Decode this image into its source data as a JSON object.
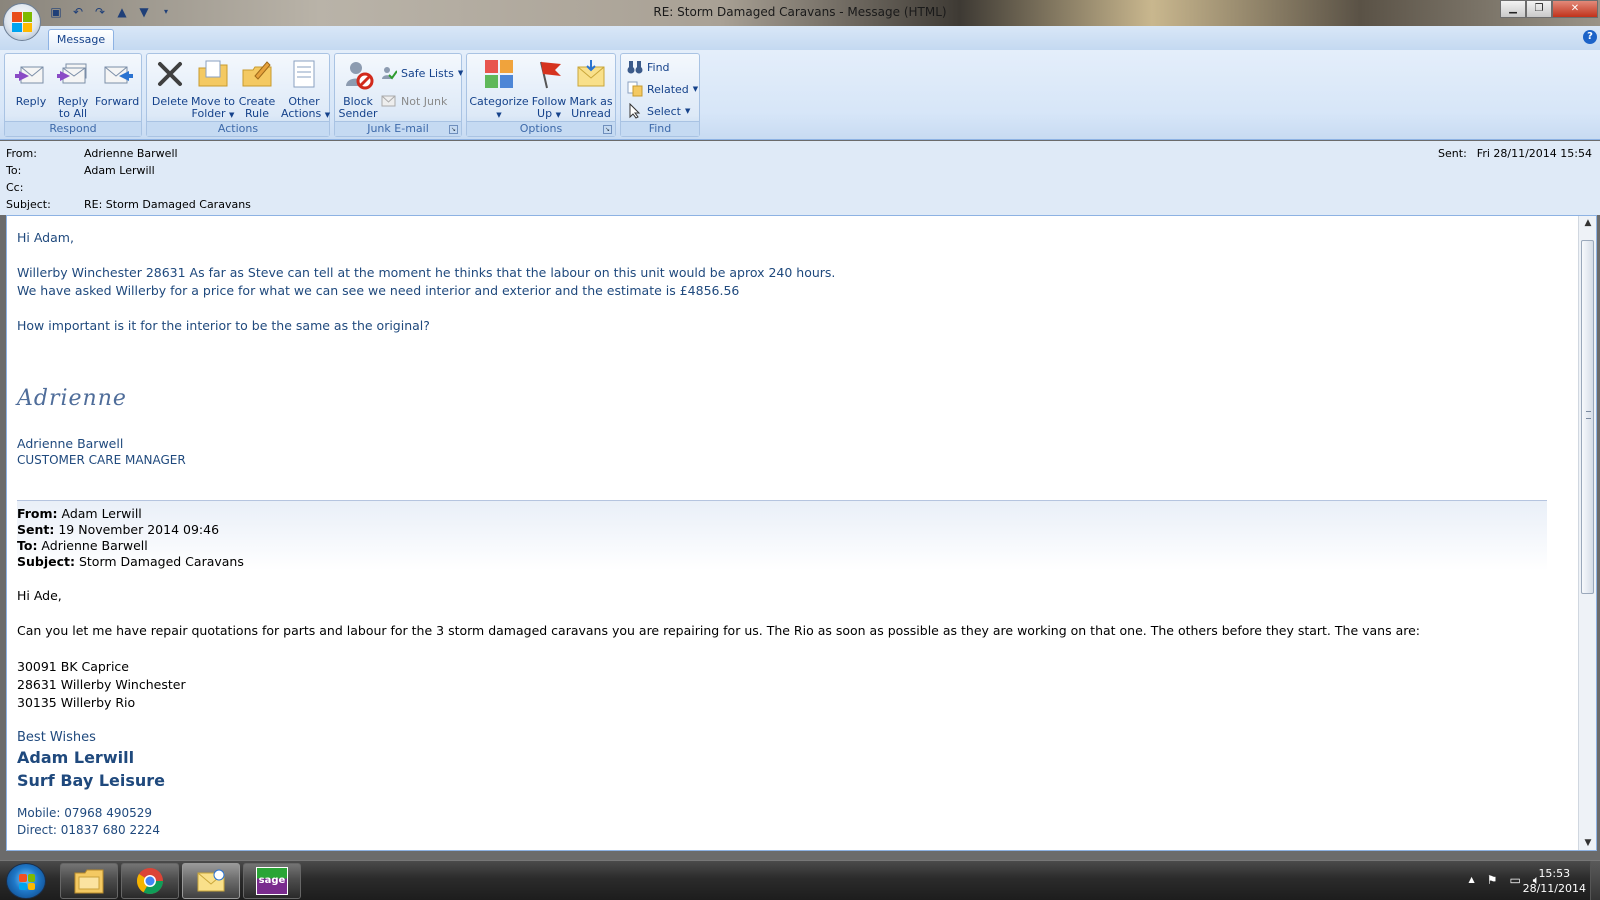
{
  "window": {
    "title": "RE: Storm Damaged Caravans - Message (HTML)",
    "minimize": "▁",
    "restore": "❐",
    "close": "✕"
  },
  "qat_icons": [
    "save-icon",
    "undo-icon",
    "redo-icon",
    "previous-item-icon",
    "next-item-icon",
    "customize-qat-icon"
  ],
  "ribbon": {
    "tab": "Message",
    "help": "?",
    "groups": {
      "respond": {
        "label": "Respond",
        "reply": "Reply",
        "reply_all_1": "Reply",
        "reply_all_2": "to All",
        "forward": "Forward"
      },
      "actions": {
        "label": "Actions",
        "delete": "Delete",
        "move_1": "Move to",
        "move_2": "Folder",
        "create_rule_1": "Create",
        "create_rule_2": "Rule",
        "other_1": "Other",
        "other_2": "Actions"
      },
      "junk": {
        "label": "Junk E-mail",
        "block_1": "Block",
        "block_2": "Sender",
        "safe_lists": "Safe Lists",
        "not_junk": "Not Junk"
      },
      "options": {
        "label": "Options",
        "categorize": "Categorize",
        "follow_1": "Follow",
        "follow_2": "Up",
        "mark_1": "Mark as",
        "mark_2": "Unread"
      },
      "find": {
        "label": "Find",
        "find": "Find",
        "related": "Related",
        "select": "Select"
      }
    }
  },
  "header": {
    "from_label": "From:",
    "from": "Adrienne Barwell",
    "to_label": "To:",
    "to": "Adam Lerwill",
    "cc_label": "Cc:",
    "cc": "",
    "subject_label": "Subject:",
    "subject": "RE: Storm Damaged Caravans",
    "sent_label": "Sent:",
    "sent": "Fri 28/11/2014 15:54"
  },
  "message": {
    "greeting": "Hi Adam,",
    "line1": "Willerby Winchester 28631 As far as Steve can tell at the moment he thinks that the labour on this unit would be aprox 240 hours.",
    "line2": "We have asked Willerby for a price for what we can see we need interior and exterior and the estimate is £4856.56",
    "line3": "How important is it for the interior to be the same as the original?",
    "signature_script": "Adrienne",
    "sig_name": "Adrienne Barwell",
    "sig_title": "CUSTOMER CARE MANAGER"
  },
  "quoted": {
    "from_label": "From:",
    "from": " Adam Lerwill",
    "sent_label": "Sent:",
    "sent": " 19 November 2014 09:46",
    "to_label": "To:",
    "to": " Adrienne Barwell",
    "subject_label": "Subject:",
    "subject": " Storm Damaged Caravans",
    "greeting": "Hi Ade,",
    "body": "Can you let me have repair quotations for parts and labour for the 3 storm damaged caravans you are repairing for us.  The Rio as soon as possible as they are working on that one.  The others before they start.   The vans are:",
    "vans": [
      "30091 BK Caprice",
      "28631 Willerby Winchester",
      "30135 Willerby Rio"
    ],
    "closing": "Best Wishes",
    "name": "Adam Lerwill",
    "company": "Surf Bay Leisure",
    "mobile": "Mobile: 07968 490529",
    "direct": "Direct:  01837 680 2224"
  },
  "taskbar": {
    "apps": [
      "windows-explorer-icon",
      "chrome-icon",
      "outlook-icon",
      "sage-icon"
    ],
    "sage_label": "sage",
    "tray_arrow": "▲",
    "time": "15:53",
    "date": "28/11/2014"
  }
}
